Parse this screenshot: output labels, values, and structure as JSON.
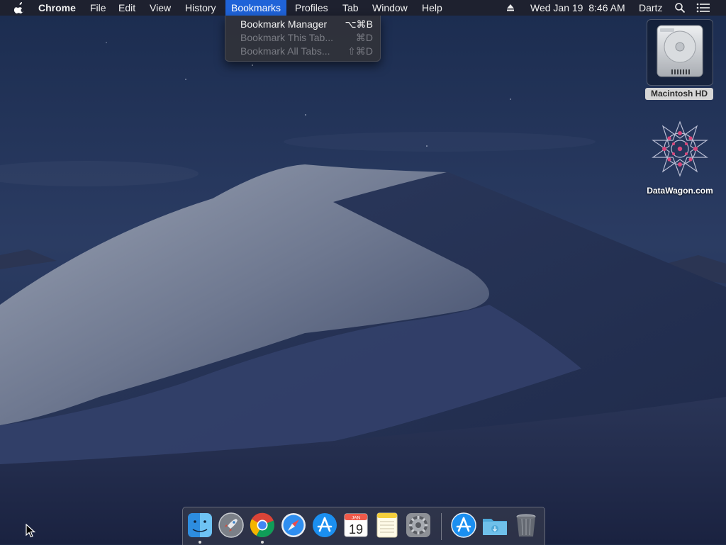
{
  "menubar": {
    "apple_icon": "apple-logo-icon",
    "app_name": "Chrome",
    "items": [
      "File",
      "Edit",
      "View",
      "History",
      "Bookmarks",
      "Profiles",
      "Tab",
      "Window",
      "Help"
    ],
    "active_item": "Bookmarks",
    "status": {
      "eject_icon": "eject-icon",
      "datetime": "Wed Jan 19  8:46 AM",
      "user": "Dartz",
      "spotlight_icon": "search-icon",
      "notification_icon": "list-icon"
    }
  },
  "bookmarks_menu": {
    "items": [
      {
        "label": "Bookmark Manager",
        "shortcut": "⌥⌘B",
        "enabled": true
      },
      {
        "label": "Bookmark This Tab...",
        "shortcut": "⌘D",
        "enabled": false
      },
      {
        "label": "Bookmark All Tabs...",
        "shortcut": "⇧⌘D",
        "enabled": false
      }
    ]
  },
  "desktop": {
    "icons": [
      {
        "label": "Macintosh HD",
        "icon": "hard-drive-icon",
        "selected": true
      },
      {
        "label": "DataWagon.com",
        "icon": "mandala-logo-icon",
        "selected": false
      }
    ]
  },
  "dock": {
    "items": [
      {
        "name": "Finder",
        "icon": "finder-icon",
        "running": true
      },
      {
        "name": "Launchpad",
        "icon": "launchpad-rocket-icon",
        "running": false
      },
      {
        "name": "Google Chrome",
        "icon": "chrome-icon",
        "running": true
      },
      {
        "name": "Safari",
        "icon": "safari-compass-icon",
        "running": false
      },
      {
        "name": "App Store",
        "icon": "app-store-icon",
        "running": false
      },
      {
        "name": "Calendar",
        "icon": "calendar-icon",
        "running": false,
        "month": "JAN",
        "day": "19"
      },
      {
        "name": "Notes",
        "icon": "notes-icon",
        "running": false
      },
      {
        "name": "System Preferences",
        "icon": "gear-icon",
        "running": false
      },
      {
        "name": "App Store",
        "icon": "app-store-icon",
        "running": false
      },
      {
        "name": "Downloads",
        "icon": "downloads-folder-icon",
        "running": false
      },
      {
        "name": "Trash",
        "icon": "trash-icon",
        "running": false
      }
    ]
  },
  "colors": {
    "menubar_bg": "#1e212c",
    "menu_highlight": "#1f63d8",
    "sky_top": "#1a2a4d",
    "dune_light": "#8f97a8"
  }
}
